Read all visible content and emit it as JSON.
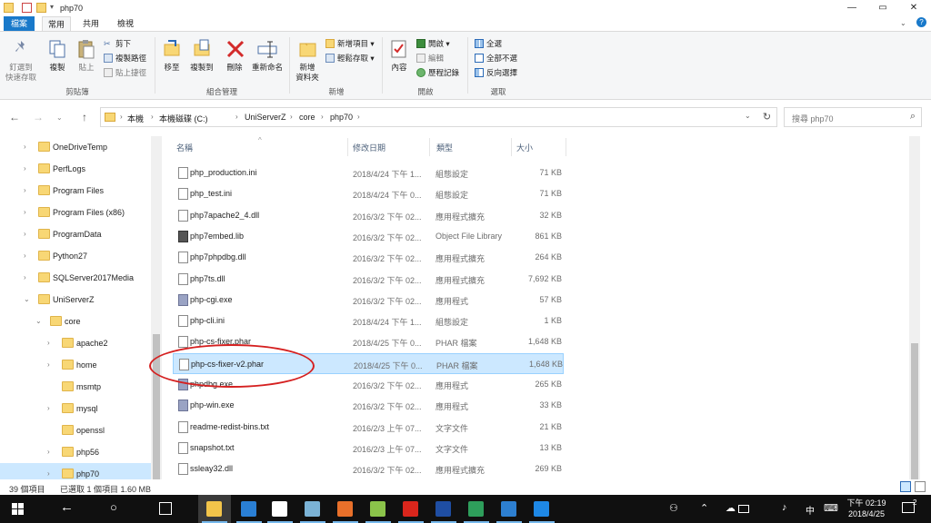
{
  "window": {
    "title": "php70",
    "controls": {
      "minimize": "—",
      "maximize": "▭",
      "close": "✕"
    }
  },
  "ribbon_tabs": {
    "file": "檔案",
    "home": "常用",
    "share": "共用",
    "view": "檢視"
  },
  "ribbon": {
    "clipboard": {
      "pin_line1": "釘選到",
      "pin_line2": "快速存取",
      "copy": "複製",
      "paste": "貼上",
      "cut": "剪下",
      "copy_path": "複製路徑",
      "paste_shortcut": "貼上捷徑",
      "group_label": "剪貼簿"
    },
    "organize": {
      "move_to": "移至",
      "copy_to": "複製到",
      "delete": "刪除",
      "rename": "重新命名",
      "group_label": "組合管理"
    },
    "new": {
      "new_folder_line1": "新增",
      "new_folder_line2": "資料夾",
      "new_item": "新增項目 ▾",
      "easy_access": "輕鬆存取 ▾",
      "group_label": "新增"
    },
    "open": {
      "properties": "內容",
      "open": "開啟 ▾",
      "edit": "編輯",
      "history": "歷程記錄",
      "group_label": "開啟"
    },
    "select": {
      "select_all": "全選",
      "select_none": "全部不選",
      "invert": "反向選擇",
      "group_label": "選取"
    }
  },
  "address": {
    "crumbs": [
      "本機",
      "本機磁碟 (C:)",
      "UniServerZ",
      "core",
      "php70"
    ],
    "search_placeholder": "搜尋 php70"
  },
  "nav_tree": [
    {
      "label": "OneDriveTemp",
      "level": 0,
      "expander": "›"
    },
    {
      "label": "PerfLogs",
      "level": 0,
      "expander": "›"
    },
    {
      "label": "Program Files",
      "level": 0,
      "expander": "›"
    },
    {
      "label": "Program Files (x86)",
      "level": 0,
      "expander": "›"
    },
    {
      "label": "ProgramData",
      "level": 0,
      "expander": "›"
    },
    {
      "label": "Python27",
      "level": 0,
      "expander": "›"
    },
    {
      "label": "SQLServer2017Media",
      "level": 0,
      "expander": "›"
    },
    {
      "label": "UniServerZ",
      "level": 0,
      "expander": "⌄"
    },
    {
      "label": "core",
      "level": 1,
      "expander": "⌄"
    },
    {
      "label": "apache2",
      "level": 2,
      "expander": "›"
    },
    {
      "label": "home",
      "level": 2,
      "expander": "›"
    },
    {
      "label": "msmtp",
      "level": 2,
      "expander": ""
    },
    {
      "label": "mysql",
      "level": 2,
      "expander": "›"
    },
    {
      "label": "openssl",
      "level": 2,
      "expander": ""
    },
    {
      "label": "php56",
      "level": 2,
      "expander": "›"
    },
    {
      "label": "php70",
      "level": 2,
      "expander": "›",
      "selected": true
    }
  ],
  "columns": {
    "name": "名稱",
    "date": "修改日期",
    "type": "類型",
    "size": "大小"
  },
  "files": [
    {
      "name": "php_production.ini",
      "date": "2018/4/24 下午 1...",
      "type": "組態設定",
      "size": "71 KB",
      "icon": "file"
    },
    {
      "name": "php_test.ini",
      "date": "2018/4/24 下午 0...",
      "type": "組態設定",
      "size": "71 KB",
      "icon": "file"
    },
    {
      "name": "php7apache2_4.dll",
      "date": "2016/3/2 下午 02...",
      "type": "應用程式擴充",
      "size": "32 KB",
      "icon": "file"
    },
    {
      "name": "php7embed.lib",
      "date": "2016/3/2 下午 02...",
      "type": "Object File Library",
      "size": "861 KB",
      "icon": "lib"
    },
    {
      "name": "php7phpdbg.dll",
      "date": "2016/3/2 下午 02...",
      "type": "應用程式擴充",
      "size": "264 KB",
      "icon": "file"
    },
    {
      "name": "php7ts.dll",
      "date": "2016/3/2 下午 02...",
      "type": "應用程式擴充",
      "size": "7,692 KB",
      "icon": "file"
    },
    {
      "name": "php-cgi.exe",
      "date": "2016/3/2 下午 02...",
      "type": "應用程式",
      "size": "57 KB",
      "icon": "exe"
    },
    {
      "name": "php-cli.ini",
      "date": "2018/4/24 下午 1...",
      "type": "組態設定",
      "size": "1 KB",
      "icon": "file"
    },
    {
      "name": "php-cs-fixer.phar",
      "date": "2018/4/25 下午 0...",
      "type": "PHAR 檔案",
      "size": "1,648 KB",
      "icon": "file"
    },
    {
      "name": "php-cs-fixer-v2.phar",
      "date": "2018/4/25 下午 0...",
      "type": "PHAR 檔案",
      "size": "1,648 KB",
      "icon": "file",
      "selected": true
    },
    {
      "name": "phpdbg.exe",
      "date": "2016/3/2 下午 02...",
      "type": "應用程式",
      "size": "265 KB",
      "icon": "exe"
    },
    {
      "name": "php-win.exe",
      "date": "2016/3/2 下午 02...",
      "type": "應用程式",
      "size": "33 KB",
      "icon": "exe"
    },
    {
      "name": "readme-redist-bins.txt",
      "date": "2016/2/3 上午 07...",
      "type": "文字文件",
      "size": "21 KB",
      "icon": "file"
    },
    {
      "name": "snapshot.txt",
      "date": "2016/2/3 上午 07...",
      "type": "文字文件",
      "size": "13 KB",
      "icon": "file"
    },
    {
      "name": "ssleay32.dll",
      "date": "2016/3/2 下午 02...",
      "type": "應用程式擴充",
      "size": "269 KB",
      "icon": "file"
    }
  ],
  "status": {
    "count": "39 個項目",
    "selected": "已選取 1 個項目 1.60 MB"
  },
  "taskbar": {
    "apps": [
      {
        "name": "task-view-icon",
        "color": "#101010"
      },
      {
        "name": "file-explorer-icon",
        "color": "#f2c44a",
        "active": true
      },
      {
        "name": "media-player-icon",
        "color": "#2a7fd4"
      },
      {
        "name": "chrome-icon",
        "color": "#ffffff"
      },
      {
        "name": "notepad-icon",
        "color": "#7bb3d6"
      },
      {
        "name": "firefox-icon",
        "color": "#e8702a"
      },
      {
        "name": "notepadplusplus-icon",
        "color": "#8bc34a"
      },
      {
        "name": "adobe-reader-icon",
        "color": "#d9261c"
      },
      {
        "name": "uniserver-icon",
        "color": "#1f4ea3"
      },
      {
        "name": "green-app-icon",
        "color": "#2e9e5b"
      },
      {
        "name": "window-app-icon",
        "color": "#2d7fd0"
      },
      {
        "name": "edge-icon",
        "color": "#1e88e5"
      }
    ],
    "ime": "中",
    "time": "下午 02:19",
    "date": "2018/4/25",
    "notifications": "2"
  }
}
